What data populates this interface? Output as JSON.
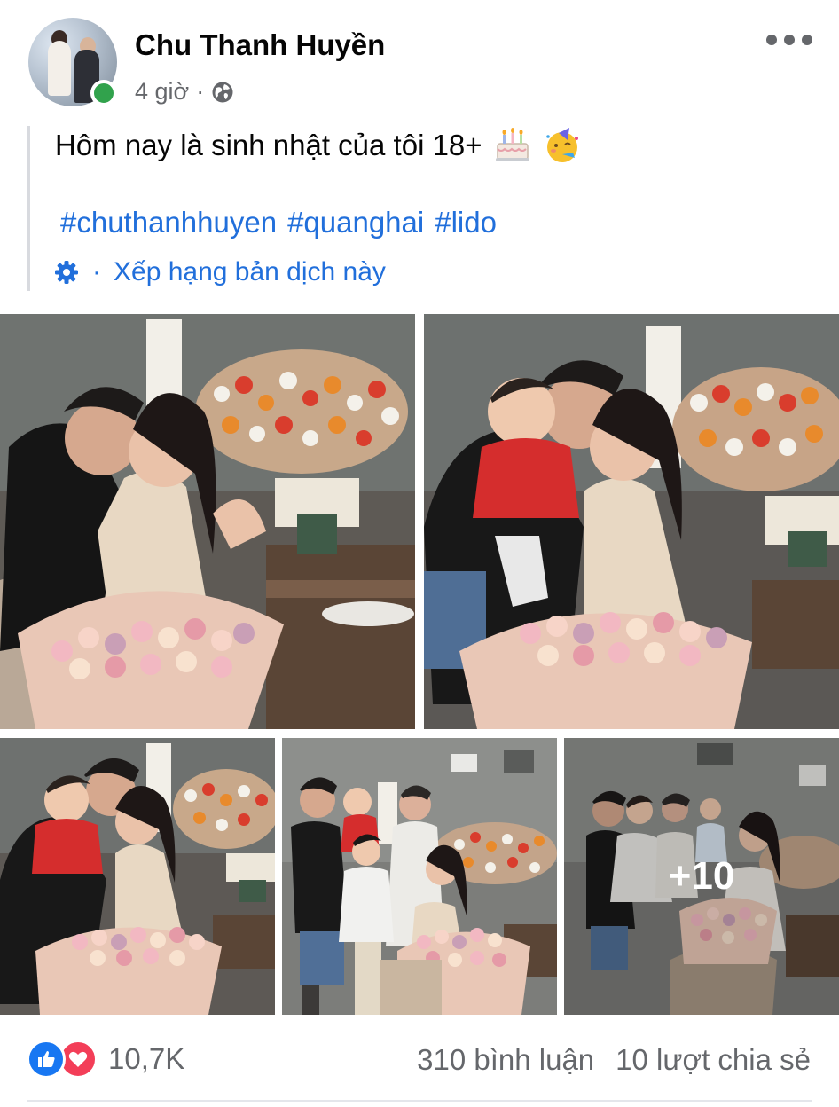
{
  "post": {
    "author": "Chu Thanh Huyền",
    "time": "4 giờ",
    "separator": "·",
    "privacy_icon": "globe-icon",
    "text": "Hôm nay là sinh nhật của tôi 18+",
    "emojis": [
      "birthday-cake-icon",
      "partying-face-icon"
    ],
    "hashtags": [
      "#chuthanhhuyen",
      "#quanghai",
      "#lido"
    ],
    "translate_sep": "·",
    "translate_label": "Xếp hạng bản dịch này"
  },
  "photos": {
    "more_count": "+10"
  },
  "footer": {
    "reaction_count": "10,7K",
    "comments": "310 bình luận",
    "shares": "10 lượt chia sẻ"
  },
  "colors": {
    "link": "#216fdb",
    "secondary_text": "#65676b",
    "online": "#31a24c",
    "like": "#1877f2",
    "love": "#f33e58"
  }
}
